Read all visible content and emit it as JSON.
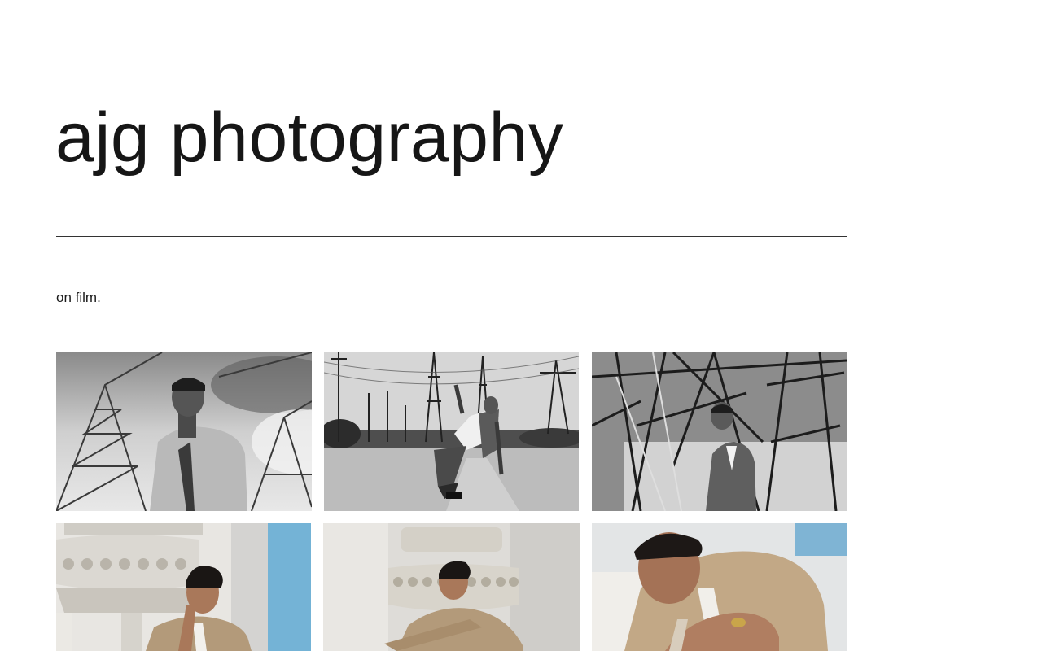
{
  "site": {
    "title": "ajg photography",
    "tagline": "on film."
  },
  "gallery": {
    "photos": [
      {
        "subject": "man in suit under power tower, black and white"
      },
      {
        "subject": "man leaning back on dirt road with power lines, black and white"
      },
      {
        "subject": "man standing beneath steel lattice tower, black and white"
      },
      {
        "subject": "man seated by ornate white column, color"
      },
      {
        "subject": "man crouching by ornate white column, color"
      },
      {
        "subject": "close-up of man with ring on hand, color"
      }
    ]
  }
}
